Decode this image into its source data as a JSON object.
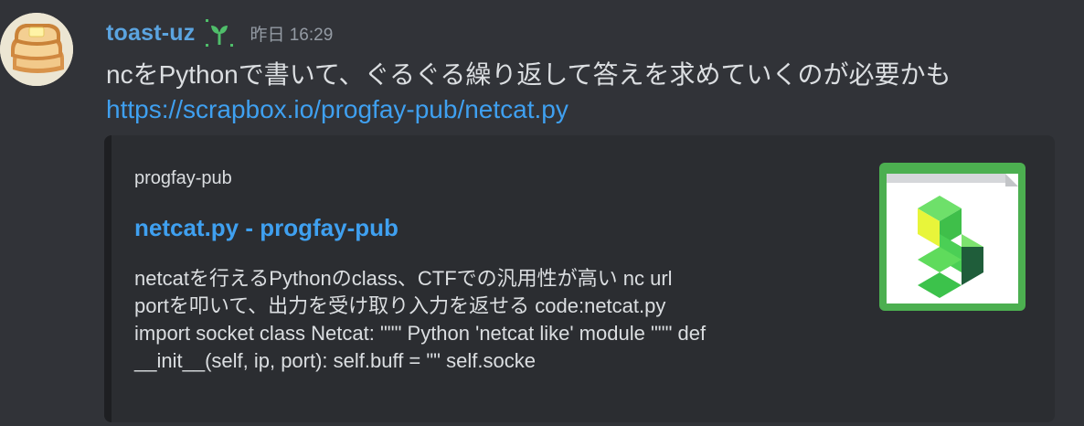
{
  "message": {
    "username": "toast-uz",
    "timestamp": "昨日 16:29",
    "text": "ncをPythonで書いて、ぐるぐる繰り返して答えを求めていくのが必要かも",
    "link": "https://scrapbox.io/progfay-pub/netcat.py"
  },
  "embed": {
    "provider": "progfay-pub",
    "title": "netcat.py - progfay-pub",
    "description_lines": [
      "netcatを行えるPythonのclass、CTFでの汎用性が高い nc url",
      "portを叩いて、出力を受け取り入力を返せる code:netcat.py",
      "import socket class Netcat: \"\"\" Python 'netcat like' module \"\"\" def",
      "__init__(self, ip, port): self.buff = \"\" self.socke"
    ],
    "thumbnail_icon": "scrapbox-logo",
    "accent_color": "#55c65b"
  },
  "icons": {
    "avatar": "toast-avatar",
    "role": "sprout-icon"
  },
  "colors": {
    "background": "#313338",
    "username": "#5ba4e0",
    "link": "#3fa0f0",
    "embed_background": "#2b2d31"
  }
}
